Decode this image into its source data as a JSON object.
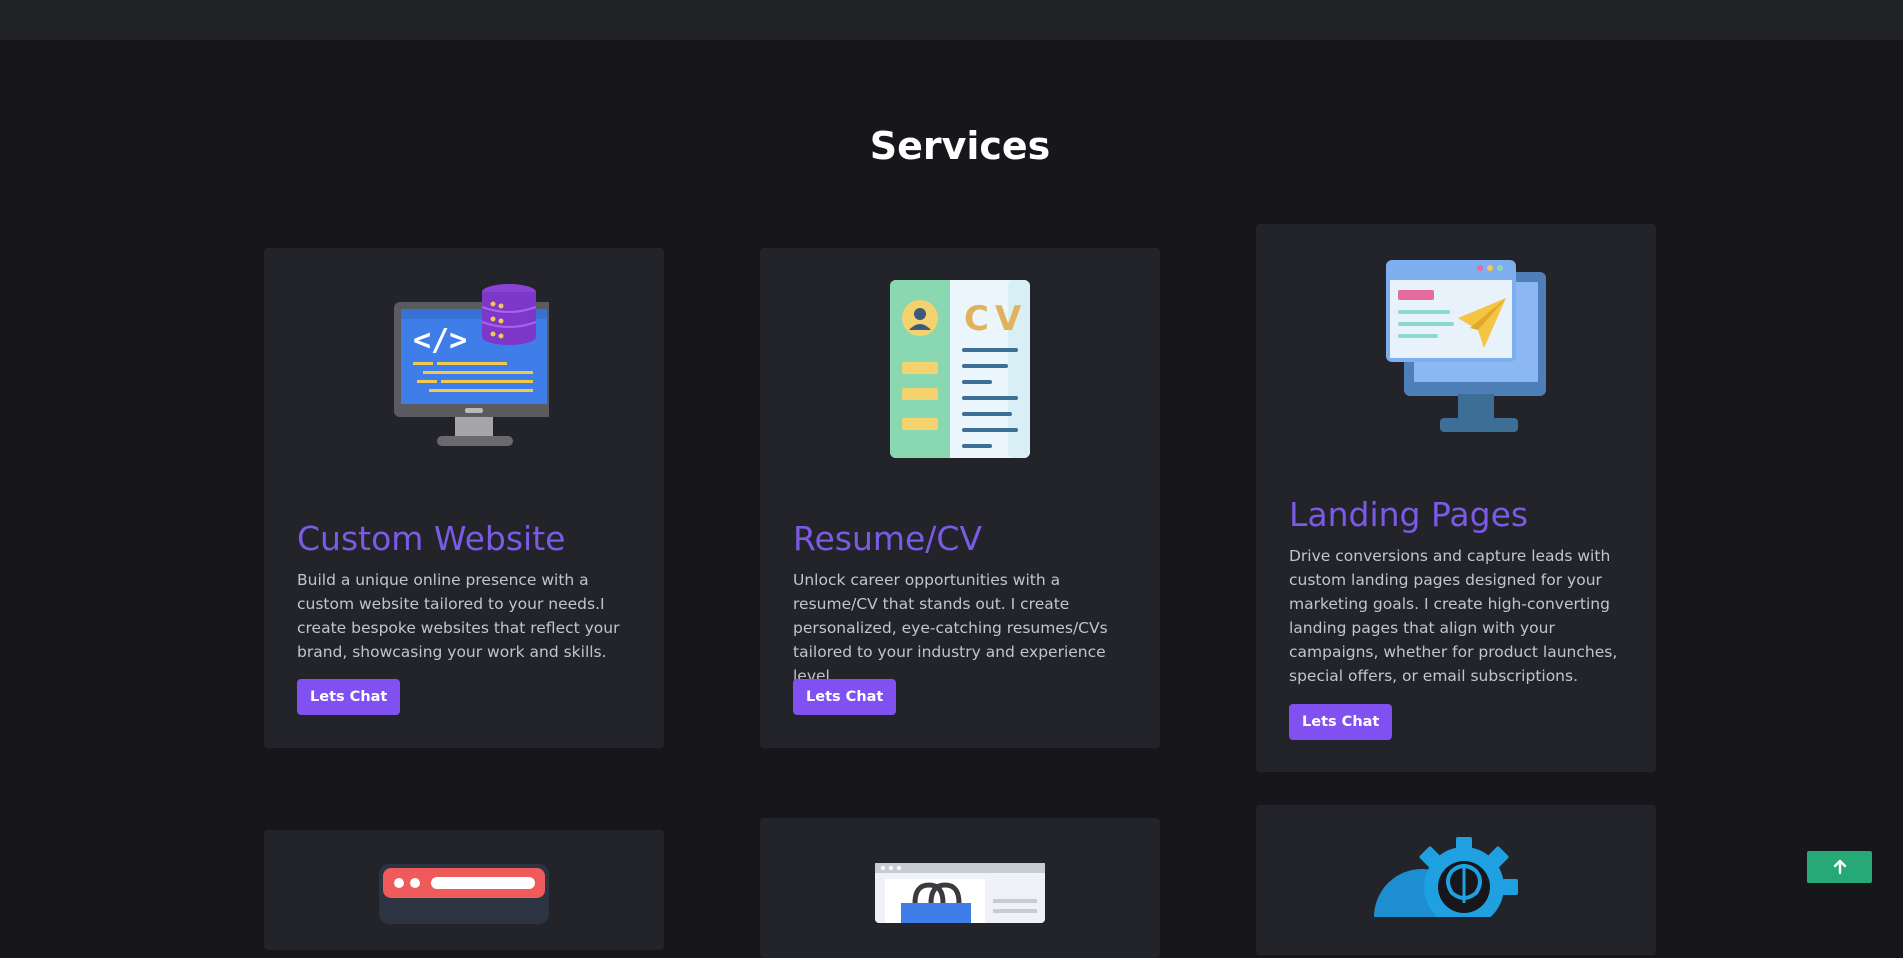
{
  "section": {
    "title": "Services"
  },
  "cards": [
    {
      "title": "Custom Website",
      "text": "Build a unique online presence with a custom website tailored to your needs.I create bespoke websites that reflect your brand, showcasing your work and skills.",
      "button": "Lets Chat",
      "icon": "web-development-icon"
    },
    {
      "title": "Resume/CV",
      "text": "Unlock career opportunities with a resume/CV that stands out. I create personalized, eye-catching resumes/CVs tailored to your industry and experience level.",
      "button": "Lets Chat",
      "icon": "resume-cv-icon",
      "cv_label": "CV"
    },
    {
      "title": "Landing Pages",
      "text": "Drive conversions and capture leads with custom landing pages designed for your marketing goals. I create high-converting landing pages that align with your campaigns, whether for product launches, special offers, or email subscriptions.",
      "button": "Lets Chat",
      "icon": "landing-page-icon"
    }
  ],
  "colors": {
    "background": "#16161b",
    "card": "#232429",
    "accent": "#7b5ae6",
    "button": "#8051f0",
    "scroll_top": "#26a877"
  },
  "scroll_top_icon": "arrow-up-icon"
}
